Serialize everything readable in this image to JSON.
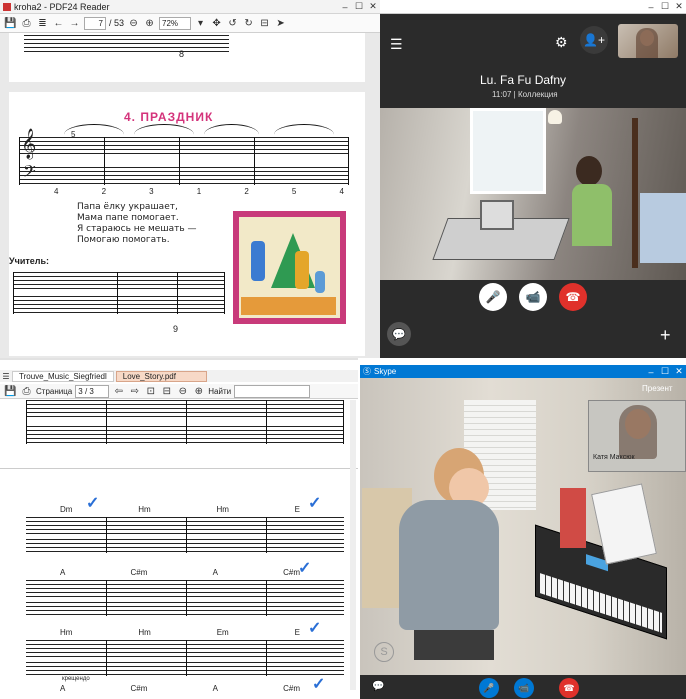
{
  "pdf_reader": {
    "window_title": "kroha2 - PDF24 Reader",
    "page_current": "7",
    "page_total": "/ 53",
    "zoom": "72%",
    "page_number_top": "8",
    "page_number_bottom": "9",
    "song_title": "4. ПРАЗДНИК",
    "poem_lines": [
      "Папа ёлку украшает,",
      "Мама папе помогает.",
      "Я стараюсь не мешать —",
      "Помогаю помогать."
    ],
    "teacher_label": "Учитель:",
    "fingering_row": [
      "4",
      "2",
      "3",
      "1",
      "2",
      "5",
      "4"
    ],
    "measure_number": "5"
  },
  "skype_top": {
    "call_title": "Lu. Fa Fu Dafny",
    "call_time": "11:07",
    "call_sub": "Коллекция"
  },
  "notation_app": {
    "tab1": "Trouve_Music_Siegfriedl",
    "tab2": "Love_Story.pdf",
    "page_label": "Страница",
    "page_value": "3 / 3",
    "find_label": "Найти",
    "chords_row1": [
      "Dm",
      "Hm",
      "Hm",
      "E"
    ],
    "chords_row2": [
      "A",
      "C#m",
      "A",
      "C#m"
    ],
    "chords_row3": [
      "Hm",
      "Hm",
      "Em",
      "E"
    ],
    "chords_row4": [
      "A",
      "C#m",
      "A",
      "C#m"
    ],
    "annotation": "крещендо"
  },
  "skype_bottom": {
    "window_title": "Skype",
    "presenter_label": "Презент",
    "self_name": "Катя Максюк"
  },
  "colors": {
    "skype_dark": "#2b2b2b",
    "skype_blue": "#0078d4",
    "end_call": "#e0312b",
    "check_blue": "#2a6fd6"
  }
}
